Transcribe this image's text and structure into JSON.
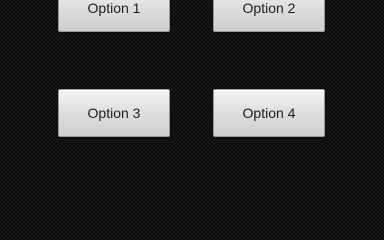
{
  "options": [
    {
      "label": "Option 1"
    },
    {
      "label": "Option 2"
    },
    {
      "label": "Option 3"
    },
    {
      "label": "Option 4"
    }
  ],
  "colors": {
    "background": "#1a1a1a",
    "button_face": "#dcdcdc",
    "button_text": "#1e1e1e"
  }
}
